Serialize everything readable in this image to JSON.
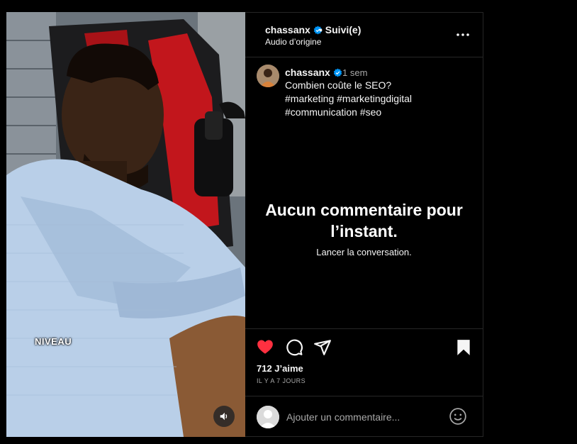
{
  "post": {
    "username": "chassanx",
    "follow_status": "• Suivi(e)",
    "audio": "Audio d’origine",
    "overlay_text": "NIVEAU"
  },
  "caption": {
    "username": "chassanx",
    "time": "1 sem",
    "lines": [
      "Combien coûte le SEO?",
      "#marketing #marketingdigital",
      "#communication #seo"
    ]
  },
  "comments": {
    "empty_title_line1": "Aucun commentaire pour",
    "empty_title_line2": "l’instant.",
    "empty_subtitle": "Lancer la conversation."
  },
  "stats": {
    "likes": "712 J’aime",
    "time_ago": "IL Y A 7 JOURS"
  },
  "composer": {
    "placeholder": "Ajouter un commentaire..."
  },
  "colors": {
    "like_red": "#ff3040",
    "verified_blue": "#0095f6",
    "panel_bg": "#000000",
    "divider": "#262626"
  },
  "icons": [
    "verified-badge-icon",
    "more-options-icon",
    "heart-icon",
    "comment-icon",
    "share-icon",
    "bookmark-icon",
    "emoji-icon",
    "speaker-icon"
  ]
}
